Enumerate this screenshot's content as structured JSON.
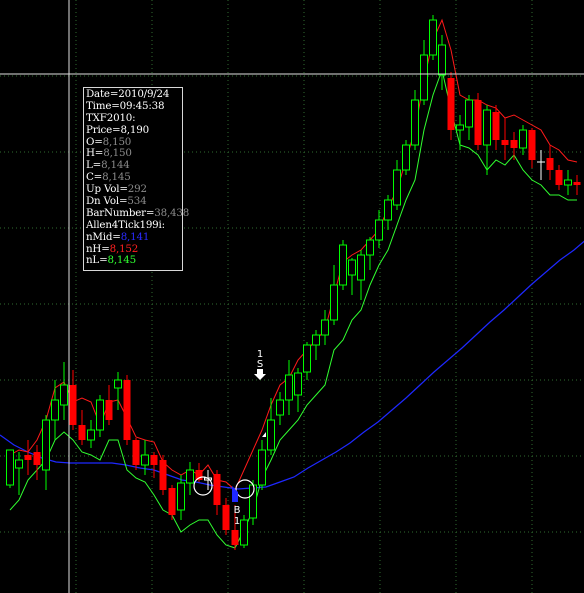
{
  "info_panel": {
    "rows": [
      {
        "label": "Date=",
        "value": "2010/9/24",
        "value_color": "white"
      },
      {
        "label": "Time=",
        "value": "09:45:38",
        "value_color": "white"
      },
      {
        "label": "TXF2010:",
        "value": "",
        "value_color": "white"
      },
      {
        "label": "Price=",
        "value": "8,190",
        "value_color": "white"
      },
      {
        "label": "O=",
        "value": "8,150",
        "value_color": "default"
      },
      {
        "label": "H=",
        "value": "8,150",
        "value_color": "default"
      },
      {
        "label": "L=",
        "value": "8,144",
        "value_color": "default"
      },
      {
        "label": "C=",
        "value": "8,145",
        "value_color": "default"
      },
      {
        "label": "Up Vol=",
        "value": "292",
        "value_color": "default"
      },
      {
        "label": "Dn Vol=",
        "value": "534",
        "value_color": "default"
      },
      {
        "label": "BarNumber=",
        "value": "38,438",
        "value_color": "default"
      },
      {
        "label": "Allen4Tick199i:",
        "value": "",
        "value_color": "white"
      },
      {
        "label": "nMid=",
        "value": "8,141",
        "value_color": "blue"
      },
      {
        "label": "nH=",
        "value": "8,152",
        "value_color": "red"
      },
      {
        "label": "nL=",
        "value": "8,145",
        "value_color": "green"
      }
    ]
  },
  "signals": {
    "sell": {
      "line1": "1",
      "line2": "S"
    },
    "buy": {
      "line1": "B",
      "line2": "1"
    }
  },
  "colors": {
    "background": "#000000",
    "grid": "#2f6b2f",
    "crosshair": "#e0e0e0",
    "up_candle": "#00ff00",
    "down_candle": "#ff0000",
    "doji": "#ffffff",
    "nMid_line": "#1e28ff",
    "nH_line": "#ff1a1a",
    "nL_line": "#30ff30"
  },
  "chart_data": {
    "type": "candlestick",
    "grid": true,
    "ohlc_relative": [
      [
        485,
        450,
        488,
        468
      ],
      [
        468,
        460,
        495,
        452
      ],
      [
        455,
        460,
        475,
        440
      ],
      [
        452,
        465,
        480,
        445
      ],
      [
        470,
        420,
        490,
        415
      ],
      [
        420,
        400,
        440,
        380
      ],
      [
        405,
        385,
        420,
        362
      ],
      [
        385,
        425,
        430,
        370
      ],
      [
        425,
        440,
        445,
        410
      ],
      [
        440,
        430,
        448,
        420
      ],
      [
        430,
        400,
        437,
        395
      ],
      [
        400,
        420,
        425,
        385
      ],
      [
        388,
        380,
        410,
        372
      ],
      [
        380,
        440,
        445,
        375
      ],
      [
        440,
        465,
        470,
        438
      ],
      [
        465,
        455,
        475,
        440
      ],
      [
        455,
        465,
        478,
        452
      ],
      [
        460,
        490,
        495,
        455
      ],
      [
        488,
        515,
        520,
        485
      ],
      [
        510,
        483,
        520,
        475
      ],
      [
        483,
        470,
        495,
        462
      ],
      [
        470,
        480,
        482,
        463
      ],
      [
        480,
        478,
        490,
        470
      ],
      [
        474,
        505,
        515,
        470
      ],
      [
        505,
        530,
        535,
        498
      ],
      [
        530,
        545,
        550,
        505
      ],
      [
        545,
        520,
        548,
        515
      ],
      [
        518,
        485,
        525,
        480
      ],
      [
        485,
        450,
        490,
        440
      ],
      [
        450,
        420,
        455,
        398
      ],
      [
        415,
        400,
        425,
        392
      ],
      [
        400,
        375,
        415,
        360
      ],
      [
        395,
        373,
        412,
        368
      ],
      [
        372,
        345,
        380,
        342
      ],
      [
        345,
        335,
        360,
        330
      ],
      [
        335,
        320,
        345,
        310
      ],
      [
        320,
        285,
        325,
        265
      ],
      [
        285,
        245,
        290,
        240
      ],
      [
        275,
        260,
        295,
        258
      ],
      [
        280,
        255,
        300,
        250
      ],
      [
        255,
        240,
        270,
        237
      ],
      [
        240,
        220,
        248,
        210
      ],
      [
        220,
        200,
        230,
        195
      ],
      [
        205,
        170,
        210,
        160
      ],
      [
        170,
        145,
        175,
        140
      ],
      [
        145,
        100,
        150,
        90
      ],
      [
        100,
        55,
        105,
        40
      ],
      [
        55,
        20,
        60,
        15
      ],
      [
        75,
        45,
        90,
        35
      ],
      [
        78,
        130,
        140,
        72
      ],
      [
        130,
        125,
        150,
        115
      ],
      [
        127,
        100,
        140,
        95
      ],
      [
        100,
        145,
        150,
        93
      ],
      [
        145,
        110,
        175,
        105
      ],
      [
        112,
        140,
        150,
        105
      ],
      [
        140,
        145,
        160,
        118
      ],
      [
        140,
        148,
        160,
        132
      ],
      [
        148,
        130,
        155,
        125
      ],
      [
        130,
        160,
        168,
        128
      ],
      [
        162,
        162,
        180,
        150
      ],
      [
        158,
        170,
        180,
        145
      ],
      [
        170,
        185,
        190,
        165
      ],
      [
        185,
        180,
        195,
        170
      ],
      [
        182,
        185,
        195,
        175
      ]
    ],
    "nH_relative": [
      455,
      450,
      452,
      440,
      420,
      388,
      382,
      402,
      398,
      402,
      425,
      402,
      400,
      418,
      437,
      440,
      442,
      462,
      470,
      475,
      470,
      475,
      465,
      480,
      482,
      490,
      470,
      450,
      430,
      405,
      385,
      378,
      360,
      350,
      340,
      330,
      295,
      262,
      255,
      250,
      240,
      230,
      208,
      190,
      160,
      130,
      80,
      40,
      20,
      50,
      95,
      100,
      100,
      105,
      108,
      118,
      115,
      120,
      125,
      130,
      145,
      150,
      160,
      162
    ],
    "nL_relative": [
      510,
      500,
      480,
      470,
      460,
      440,
      432,
      440,
      452,
      455,
      460,
      440,
      440,
      470,
      478,
      482,
      495,
      510,
      515,
      532,
      525,
      520,
      520,
      535,
      545,
      548,
      530,
      510,
      478,
      460,
      440,
      430,
      420,
      405,
      395,
      385,
      350,
      340,
      320,
      310,
      285,
      265,
      250,
      225,
      200,
      180,
      130,
      95,
      70,
      110,
      145,
      148,
      155,
      170,
      160,
      165,
      155,
      170,
      180,
      185,
      195,
      195,
      200,
      200
    ],
    "nMid_relative": [
      435,
      445,
      452,
      458,
      462,
      463,
      463,
      463,
      463,
      465,
      468,
      470,
      475,
      480,
      482,
      485,
      487,
      489,
      488,
      487,
      482,
      477,
      468,
      460,
      452,
      443,
      432,
      422,
      410,
      398,
      385,
      372,
      360,
      348,
      335,
      322,
      310,
      297,
      284,
      272,
      260,
      250,
      238
    ],
    "signals": [
      {
        "label": "1 S",
        "type": "sell",
        "bar": 36
      },
      {
        "label": "B 1",
        "type": "buy",
        "bar": 25
      }
    ]
  }
}
